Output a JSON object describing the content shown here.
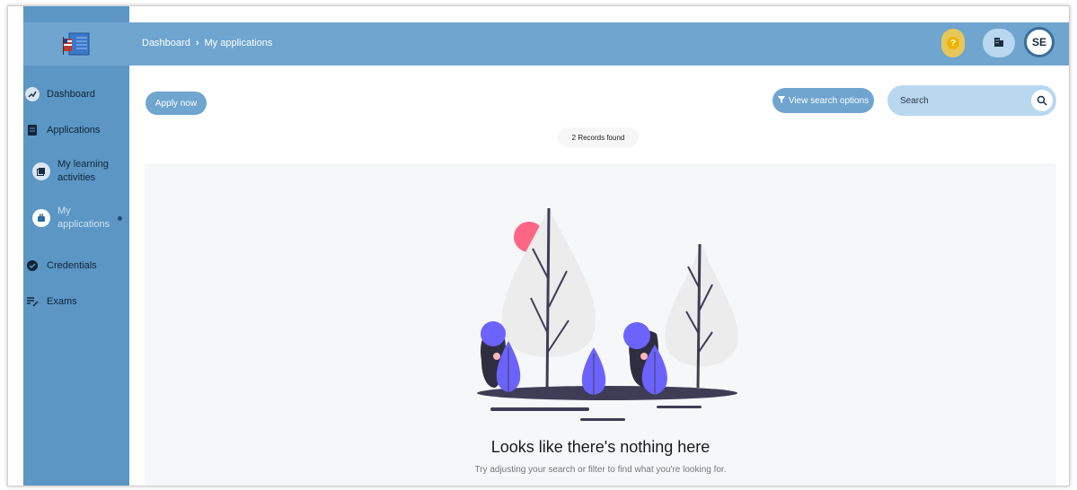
{
  "sidebar": {
    "items": [
      {
        "label": "Dashboard",
        "icon": "trending-up-icon"
      },
      {
        "label": "Applications",
        "icon": "document-icon"
      },
      {
        "label": "My learning activities",
        "icon": "library-icon"
      },
      {
        "label": "My applications",
        "icon": "briefcase-icon",
        "active": true
      },
      {
        "label": "Credentials",
        "icon": "verified-badge-icon"
      },
      {
        "label": "Exams",
        "icon": "edit-list-icon"
      }
    ]
  },
  "header": {
    "breadcrumb": [
      "Dashboard",
      "My applications"
    ],
    "avatar_initials": "SE",
    "help_icon": "question-icon",
    "org_icon": "building-icon"
  },
  "toolbar": {
    "apply_label": "Apply now",
    "view_search_label": "View search options",
    "search_placeholder": "Search"
  },
  "records_label": "2 Records found",
  "empty_state": {
    "title": "Looks like there's nothing here",
    "subtitle": "Try adjusting your search or filter to find what you're looking for."
  },
  "colors": {
    "sidebar": "#5b96c4",
    "header": "#6fa5cf",
    "help_button": "#e6c85a",
    "accent_purple": "#6c63ff",
    "accent_pink": "#ff6584"
  }
}
